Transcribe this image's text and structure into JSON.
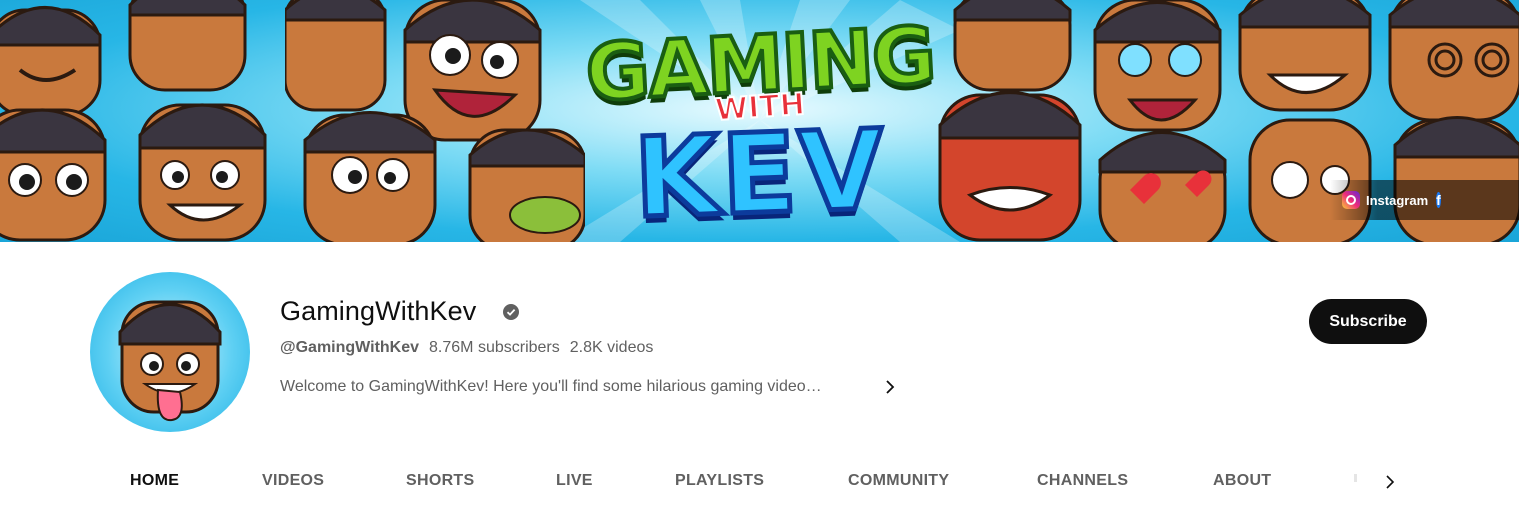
{
  "banner": {
    "title_top": "GAMING",
    "title_mid": "WITH",
    "title_bottom": "KEV",
    "links": [
      {
        "label": "Instagram",
        "icon": "instagram-icon"
      },
      {
        "label": "",
        "icon": "facebook-icon"
      }
    ]
  },
  "channel": {
    "name": "GamingWithKev",
    "verified_icon": "verified-check-icon",
    "handle": "@GamingWithKev",
    "subscribers": "8.76M subscribers",
    "videos": "2.8K videos",
    "description": "Welcome to GamingWithKev! Here you'll find some hilarious gaming video…",
    "subscribe_label": "Subscribe"
  },
  "tabs": [
    {
      "label": "HOME",
      "active": true
    },
    {
      "label": "VIDEOS",
      "active": false
    },
    {
      "label": "SHORTS",
      "active": false
    },
    {
      "label": "LIVE",
      "active": false
    },
    {
      "label": "PLAYLISTS",
      "active": false
    },
    {
      "label": "COMMUNITY",
      "active": false
    },
    {
      "label": "CHANNELS",
      "active": false
    },
    {
      "label": "ABOUT",
      "active": false
    }
  ],
  "colors": {
    "subscribe_bg": "#0f0f0f",
    "secondary_text": "#606060",
    "banner_sky": "#27b6e6"
  }
}
